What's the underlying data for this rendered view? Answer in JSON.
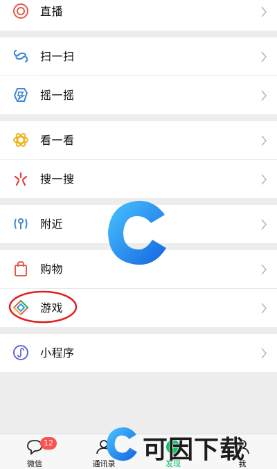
{
  "menu": {
    "live": "直播",
    "scan": "扫一扫",
    "shake": "摇一摇",
    "look": "看一看",
    "search": "搜一搜",
    "nearby": "附近",
    "shopping": "购物",
    "games": "游戏",
    "mini_programs": "小程序"
  },
  "icons": {
    "live": "live-icon",
    "scan": "scan-icon",
    "shake": "shake-icon",
    "look": "look-icon",
    "search": "search-icon",
    "nearby": "nearby-icon",
    "shopping": "shopping-bag-icon",
    "games": "games-icon",
    "mini_programs": "mini-program-icon",
    "chevron": "chevron-right-icon"
  },
  "tabbar": {
    "chats": "微信",
    "chats_badge": "12",
    "contacts": "通讯录",
    "discover": "发现",
    "me": "我"
  },
  "watermark": {
    "text": "可因下载"
  },
  "colors": {
    "active_tab": "#07c160",
    "badge": "#fa5151",
    "annotation": "#e02020",
    "watermark_blue": "#1e90ff"
  }
}
